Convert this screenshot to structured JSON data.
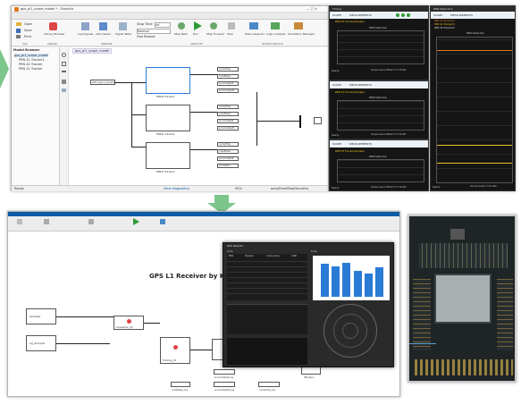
{
  "top": {
    "window_title": "gps_pl1_scope_model * - Simulink",
    "tabs": [
      "SIMULATION",
      "DEBUG",
      "MODELING",
      "FORMAT",
      "APPS",
      "SUBSYSTEM BLOCK"
    ],
    "toolbar_left": [
      "Open",
      "Save",
      "Print"
    ],
    "toolbar_main": [
      "Library Browser",
      "Log Signals",
      "Add Viewer",
      "Signal Table",
      "Step Back",
      "Run",
      "Step Forward",
      "Stop",
      "Data Inspector",
      "Logic Analyzer",
      "Simulation Manager"
    ],
    "stop_time_label": "Stop Time",
    "stop_time_value": "inf",
    "mode_value": "Normal",
    "fast_restart": "Fast Restart",
    "section_labels": [
      "FILE",
      "LIBRARY",
      "PREPARE",
      "SIMULATE",
      "REVIEW RESULTS"
    ],
    "browser_title": "Model Browser",
    "tree": [
      "gps_pl1_scope_model",
      "PRN 41 Tracker1",
      "PRN 40 Tracker",
      "PRN 41 Tracker"
    ],
    "model_tab": "gps_pl1_scope_model",
    "source_block": "GPS_Signal_Sample",
    "trackers": [
      "PRN40 Tracker1",
      "PRN41 Tracker2",
      "PRN35 Tracker3"
    ],
    "outputs": [
      "carrierFreq",
      "codePhase",
      "accumulatedI",
      "accumulatedQ",
      "lockStatus"
    ],
    "status_ready": "Ready",
    "status_zoom": "94%",
    "status_right": "View diagnostics",
    "status_solver": "auto(FixedStepDiscrete)"
  },
  "scopes": {
    "left_title": "Timing",
    "right_title": "PRN Detection",
    "scope_tab": "SCOPE",
    "meas_tab": "MEASUREMENTS",
    "panels": [
      {
        "legend": "PRN 40 Tracker/Doppler",
        "plot_title": "PRN Detection",
        "status": "Ready",
        "sample": "Sample based  Offset=0  T=10.000"
      },
      {
        "legend": "PRN 41 Tracker/Doppler",
        "plot_title": "PRN Detection",
        "status": "Ready",
        "sample": "Sample based  Offset=0  T=10.000"
      },
      {
        "legend": "PRN 35 Tracker/Doppler",
        "plot_title": "PRN Detection",
        "status": "Ready",
        "sample": "Sample based  Offset=0  T=10.000"
      }
    ],
    "right_legend": [
      "PRN 40 Tracker/O",
      "PRN 41 Tracker/O",
      "PRN 35 Tracker/O"
    ],
    "right_plot_title": "PRN Detection",
    "right_status": "Ready",
    "right_sample": "Sample based  T=10.000"
  },
  "bottom": {
    "diagram_title": "GPS L1 Receiver by KEVIN(JSC",
    "popup_title": "GPS Results",
    "popup_labels": [
      "Data",
      "Data"
    ],
    "table_head": [
      "PRN",
      "Doppler",
      "Code phase",
      "C/N0"
    ],
    "blocks": [
      "Sampler",
      "ag_Sampler",
      "Tracking_01",
      "Acquisition_01",
      "Tracking_02",
      "SPI_Recv",
      "Channel"
    ],
    "small_labels": [
      "accumulatedI_log",
      "accumulatedQ_log",
      "codePhase_log",
      "carrierFreq_log",
      "lockStatus_log"
    ],
    "chart": {
      "type": "bar",
      "values": [
        0.88,
        0.82,
        0.9,
        0.7,
        0.62,
        0.78
      ]
    }
  },
  "colors": {
    "accent": "#0a5aa6",
    "scope_bg": "#151515",
    "trace_yellow": "#e8c21a",
    "trace_orange": "#e07a1e",
    "bar_blue": "#2a7bd6",
    "arrow_green": "#7cc68b",
    "board_dark": "#1f2426"
  }
}
